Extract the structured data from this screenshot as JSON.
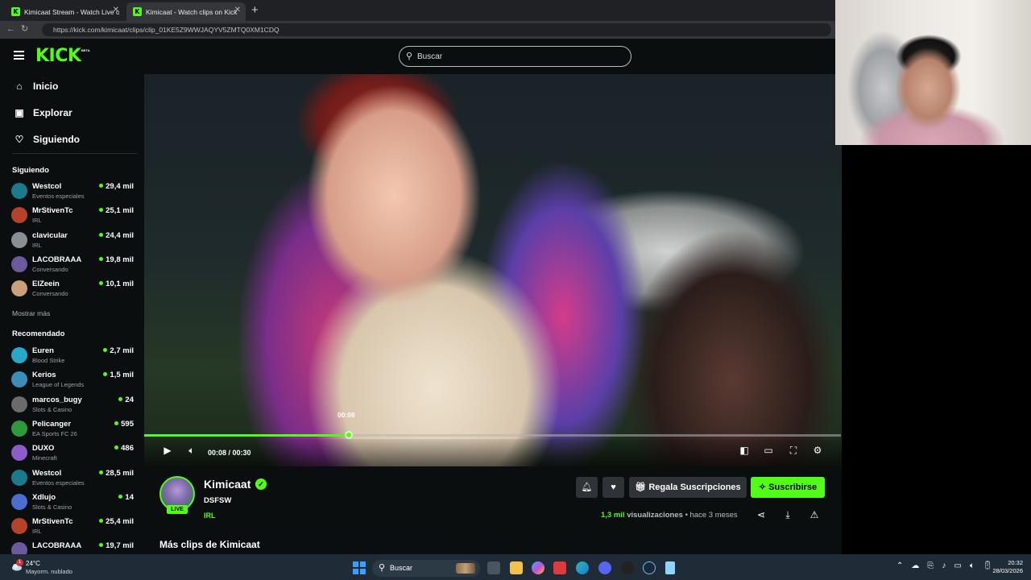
{
  "browser": {
    "tabs": [
      {
        "title": "Kimicaat Stream - Watch Live on Kick",
        "favicon": "K"
      },
      {
        "title": "Kimicaat - Watch clips on Kick",
        "favicon": "K"
      }
    ],
    "url": "https://kick.com/kimicaat/clips/clip_01KE5Z9WWJAQYV5ZMTQ0XM1CDQ"
  },
  "header": {
    "logo": "KICK",
    "logo_badge": "BETA",
    "search_placeholder": "Buscar"
  },
  "sidebar": {
    "nav": [
      {
        "label": "Inicio",
        "icon": "home-icon"
      },
      {
        "label": "Explorar",
        "icon": "browse-icon"
      },
      {
        "label": "Siguiendo",
        "icon": "heart-icon"
      }
    ],
    "following_title": "Siguiendo",
    "following": [
      {
        "name": "Westcol",
        "category": "Eventos especiales",
        "viewers": "29,4 mil",
        "color": "#1b7a8c"
      },
      {
        "name": "MrStivenTc",
        "category": "IRL",
        "viewers": "25,1 mil",
        "color": "#b5432a"
      },
      {
        "name": "clavicular",
        "category": "IRL",
        "viewers": "24,4 mil",
        "color": "#8a8f96"
      },
      {
        "name": "LACOBRAAA",
        "category": "Conversando",
        "viewers": "19,8 mil",
        "color": "#6c5a9e"
      },
      {
        "name": "ElZeein",
        "category": "Conversando",
        "viewers": "10,1 mil",
        "color": "#c9a07a"
      }
    ],
    "show_more": "Mostrar más",
    "recommended_title": "Recomendado",
    "recommended": [
      {
        "name": "Euren",
        "category": "Blood Strike",
        "viewers": "2,7 mil",
        "color": "#2aa6c8"
      },
      {
        "name": "Kerios",
        "category": "League of Legends",
        "viewers": "1,5 mil",
        "color": "#3a8fb8"
      },
      {
        "name": "marcos_bugy",
        "category": "Slots & Casino",
        "viewers": "24",
        "color": "#6b6b6b"
      },
      {
        "name": "Pelicanger",
        "category": "EA Sports FC 26",
        "viewers": "595",
        "color": "#2e9a3b"
      },
      {
        "name": "DUXO",
        "category": "Minecraft",
        "viewers": "486",
        "color": "#8e5cc8"
      },
      {
        "name": "Westcol",
        "category": "Eventos especiales",
        "viewers": "28,5 mil",
        "color": "#1b7a8c"
      },
      {
        "name": "Xdlujo",
        "category": "Slots & Casino",
        "viewers": "14",
        "color": "#4a6fd0"
      },
      {
        "name": "MrStivenTc",
        "category": "IRL",
        "viewers": "25,4 mil",
        "color": "#b5432a"
      },
      {
        "name": "LACOBRAAA",
        "category": "",
        "viewers": "19,7 mil",
        "color": "#6c5a9e"
      }
    ]
  },
  "player": {
    "hover_time": "00:08",
    "timecode": "00:08 / 00:30",
    "progress": 0.2935
  },
  "clip": {
    "channel": "Kimicaat",
    "live_badge": "LIVE",
    "title": "DSFSW",
    "category": "IRL",
    "gift_label": "Regala Suscripciones",
    "subscribe_label": "Suscribirse",
    "views": "1,3 mil",
    "views_label": "visualizaciones",
    "age": "hace 3 meses",
    "more_clips": "Más clips de Kimicaat"
  },
  "taskbar": {
    "temperature": "24°C",
    "weather": "Mayorm. nublado",
    "weather_badge": "1",
    "search_label": "Buscar",
    "time": "20:32",
    "date": "28/03/2026"
  },
  "colors": {
    "accent": "#53fc18",
    "background": "#0b0e0f"
  }
}
